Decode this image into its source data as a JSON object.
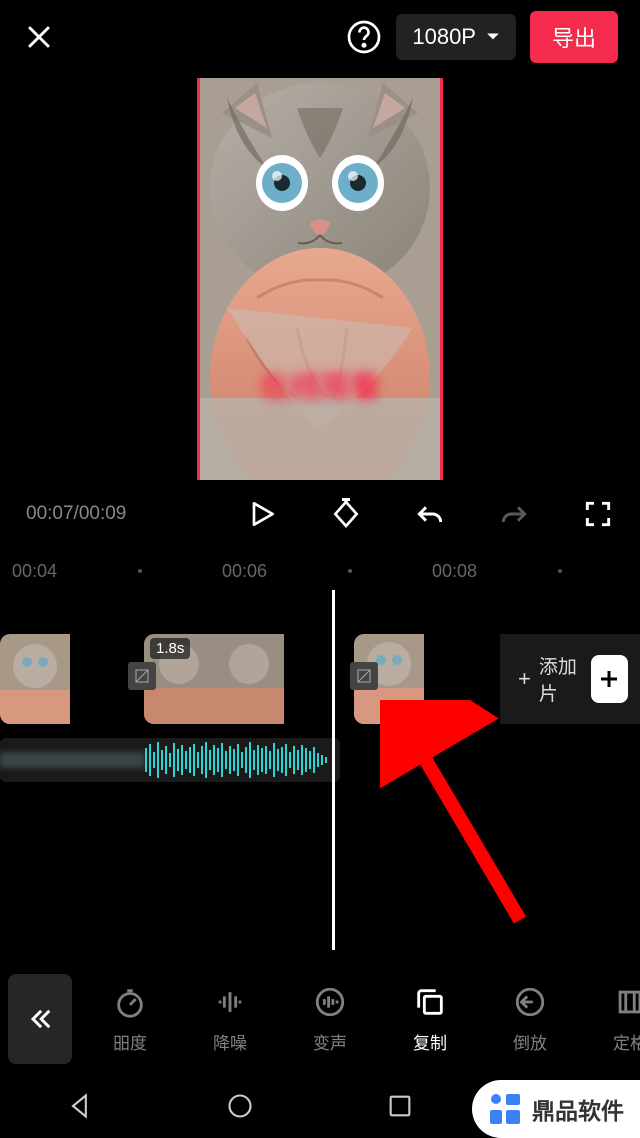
{
  "header": {
    "resolution": "1080P",
    "export": "导出"
  },
  "time": {
    "current": "00:07",
    "total": "00:09",
    "display": "00:07/00:09"
  },
  "ruler": {
    "t1": "00:04",
    "t2": "00:06",
    "t3": "00:08"
  },
  "clips": {
    "clip2_duration": "1.8s",
    "add_segment": "添加片"
  },
  "tools": [
    {
      "id": "speed",
      "label": "昍度",
      "dim": true
    },
    {
      "id": "denoise",
      "label": "降噪",
      "dim": true
    },
    {
      "id": "voice",
      "label": "变声",
      "dim": true
    },
    {
      "id": "copy",
      "label": "复制",
      "dim": false
    },
    {
      "id": "reverse",
      "label": "倒放",
      "dim": true
    },
    {
      "id": "freeze",
      "label": "定格",
      "dim": true
    }
  ],
  "brand": "鼎品软件",
  "preview_overlay": "在线观看"
}
